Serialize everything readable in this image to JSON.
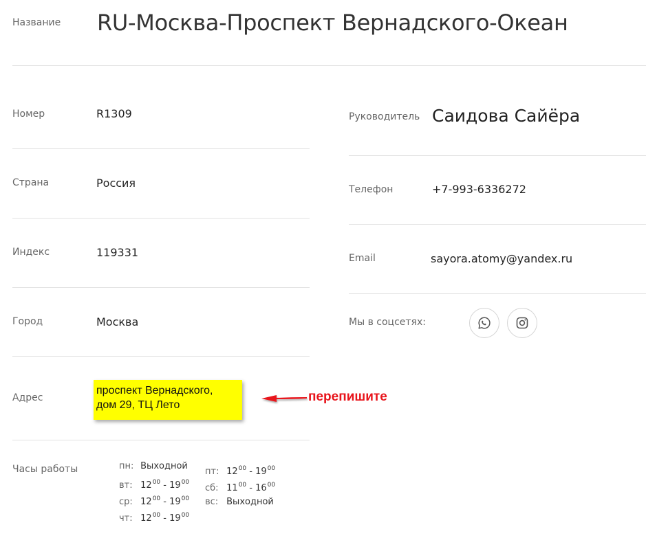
{
  "title": {
    "label": "Название",
    "value": "RU-Москва-Проспект Вернадского-Океан"
  },
  "left_fields": [
    {
      "label": "Номер",
      "value": "R1309"
    },
    {
      "label": "Страна",
      "value": "Россия"
    },
    {
      "label": "Индекс",
      "value": "119331"
    },
    {
      "label": "Город",
      "value": "Москва"
    }
  ],
  "address": {
    "label": "Адрес",
    "line1": "проспект Вернадского,",
    "line2": "дом 29, ТЦ Лето",
    "annotation": "перепишите"
  },
  "right_fields": {
    "manager": {
      "label": "Руководитель",
      "value": "Саидова Сайёра"
    },
    "phone": {
      "label": "Телефон",
      "value": "+7-993-6336272"
    },
    "email": {
      "label": "Email",
      "value": "sayora.atomy@yandex.ru"
    },
    "social": {
      "label": "Мы в соцсетях:",
      "icons": [
        "whatsapp-icon",
        "instagram-icon"
      ]
    }
  },
  "hours": {
    "label": "Часы работы",
    "col1": [
      {
        "day": "пн:",
        "text": "Выходной"
      },
      {
        "day": "вт:",
        "open_h": "12",
        "open_m": "00",
        "sep": "-",
        "close_h": "19",
        "close_m": "00"
      },
      {
        "day": "ср:",
        "open_h": "12",
        "open_m": "00",
        "sep": "-",
        "close_h": "19",
        "close_m": "00"
      },
      {
        "day": "чт:",
        "open_h": "12",
        "open_m": "00",
        "sep": "-",
        "close_h": "19",
        "close_m": "00"
      }
    ],
    "col2": [
      {
        "day": "пт:",
        "open_h": "12",
        "open_m": "00",
        "sep": "-",
        "close_h": "19",
        "close_m": "00"
      },
      {
        "day": "сб:",
        "open_h": "11",
        "open_m": "00",
        "sep": "-",
        "close_h": "16",
        "close_m": "00"
      },
      {
        "day": "вс:",
        "text": "Выходной"
      }
    ]
  },
  "colors": {
    "highlight": "#ffff00",
    "annotation": "#e8141b",
    "divider": "#e2e2e2"
  }
}
